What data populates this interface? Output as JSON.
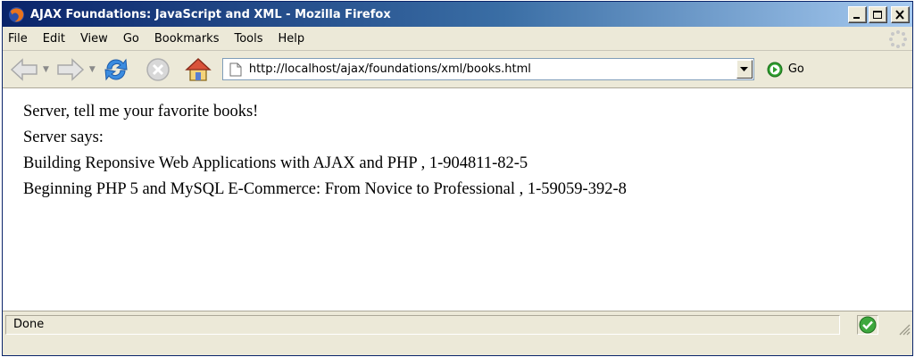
{
  "window": {
    "title": "AJAX Foundations: JavaScript and XML - Mozilla Firefox"
  },
  "menu": {
    "items": [
      "File",
      "Edit",
      "View",
      "Go",
      "Bookmarks",
      "Tools",
      "Help"
    ]
  },
  "navigation": {
    "url": "http://localhost/ajax/foundations/xml/books.html",
    "go_label": "Go",
    "icons": [
      "back-arrow-icon",
      "forward-arrow-icon",
      "reload-icon",
      "stop-icon",
      "home-icon",
      "page-icon",
      "go-icon"
    ]
  },
  "content": {
    "lines": [
      "Server, tell me your favorite books!",
      "Server says:",
      "Building Reponsive Web Applications with AJAX and PHP , 1-904811-82-5",
      "Beginning PHP 5 and MySQL E-Commerce: From Novice to Professional , 1-59059-392-8"
    ]
  },
  "status": {
    "text": "Done"
  },
  "colors": {
    "titlebar_start": "#0a246a",
    "titlebar_end": "#a6caf0",
    "chrome": "#ece9d8",
    "go_green": "#2e9e2e"
  }
}
